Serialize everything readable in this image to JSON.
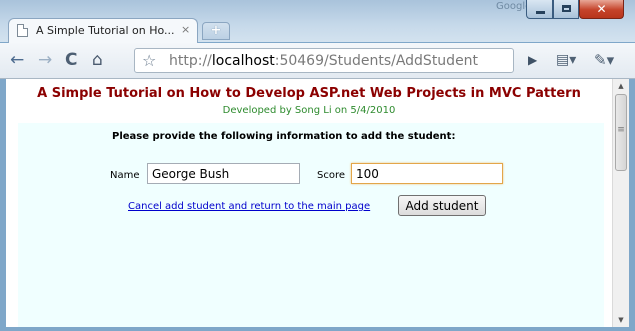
{
  "window": {
    "google_label": "Google",
    "minimize_label": "minimize",
    "maximize_label": "maximize",
    "close_label": "✕"
  },
  "tab": {
    "title": "A Simple Tutorial on Ho...",
    "close_glyph": "×",
    "new_tab_glyph": "+"
  },
  "toolbar": {
    "back_glyph": "←",
    "forward_glyph": "→",
    "reload_glyph": "C",
    "home_glyph": "⌂",
    "star_glyph": "☆",
    "url_prefix": "http://",
    "url_host": "localhost",
    "url_rest": ":50469/Students/AddStudent",
    "go_glyph": "▶",
    "page_menu_glyph": "▤▾",
    "wrench_glyph": "✎▾"
  },
  "page": {
    "title": "A Simple Tutorial on How to Develop ASP.net Web Projects in MVC Pattern",
    "subtitle": "Developed by Song Li on 5/4/2010",
    "instruction": "Please provide the following information to add the student:",
    "name_label": "Name",
    "name_value": "George Bush",
    "score_label": "Score",
    "score_value": "100",
    "cancel_link": "Cancel add student and return to the main page",
    "add_button": "Add student"
  },
  "icons": {
    "tab_icon": "page-icon",
    "back": "back-arrow-icon",
    "forward": "forward-arrow-icon",
    "reload": "reload-icon",
    "home": "home-icon",
    "star": "star-icon",
    "go": "go-icon",
    "page_menu": "page-menu-icon",
    "wrench": "wrench-icon"
  }
}
